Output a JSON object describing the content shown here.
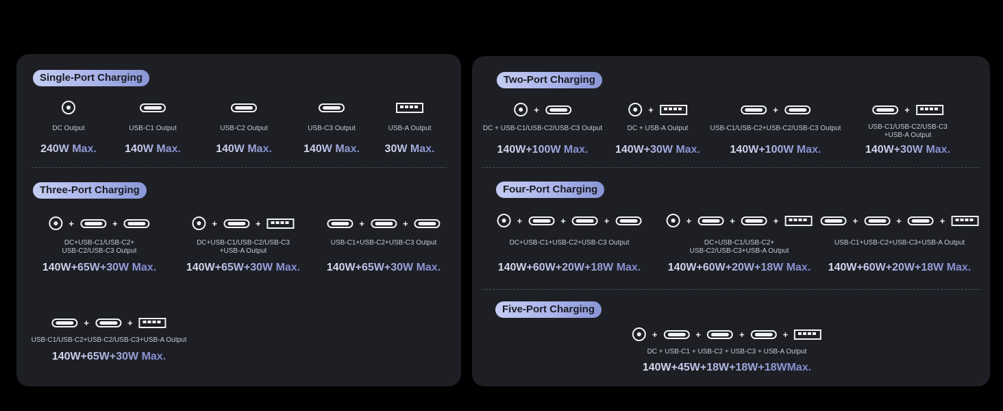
{
  "left": {
    "single": {
      "title": "Single-Port Charging",
      "items": [
        {
          "label": "DC Output",
          "value": "240W Max.",
          "icons": [
            "dc-icon"
          ]
        },
        {
          "label": "USB-C1 Output",
          "value": "140W Max.",
          "icons": [
            "usb-c-icon"
          ]
        },
        {
          "label": "USB-C2 Output",
          "value": "140W Max.",
          "icons": [
            "usb-c-icon"
          ]
        },
        {
          "label": "USB-C3 Output",
          "value": "140W Max.",
          "icons": [
            "usb-c-icon"
          ]
        },
        {
          "label": "USB-A Output",
          "value": "30W Max.",
          "icons": [
            "usb-a-icon"
          ]
        }
      ]
    },
    "three": {
      "title": "Three-Port Charging",
      "items": [
        {
          "label": "DC+USB-C1/USB-C2+\nUSB-C2/USB-C3 Output",
          "value": "140W+65W+30W Max.",
          "icons": [
            "dc-icon",
            "usb-c-icon",
            "usb-c-icon"
          ]
        },
        {
          "label": "DC+USB-C1/USB-C2/USB-C3\n+USB-A Output",
          "value": "140W+65W+30W Max.",
          "icons": [
            "dc-icon",
            "usb-c-icon",
            "usb-a-icon"
          ]
        },
        {
          "label": "USB-C1+USB-C2+USB-C3 Output",
          "value": "140W+65W+30W Max.",
          "icons": [
            "usb-c-icon",
            "usb-c-icon",
            "usb-c-icon"
          ]
        },
        {
          "label": "USB-C1/USB-C2+USB-C2/USB-C3+USB-A Output",
          "value": "140W+65W+30W Max.",
          "icons": [
            "usb-c-icon",
            "usb-c-icon",
            "usb-a-icon"
          ]
        }
      ]
    }
  },
  "right": {
    "two": {
      "title": "Two-Port Charging",
      "items": [
        {
          "label": "DC + USB-C1/USB-C2/USB-C3 Output",
          "value": "140W+100W Max.",
          "icons": [
            "dc-icon",
            "usb-c-icon"
          ]
        },
        {
          "label": "DC + USB-A Output",
          "value": "140W+30W Max.",
          "icons": [
            "dc-icon",
            "usb-a-icon"
          ]
        },
        {
          "label": "USB-C1/USB-C2+USB-C2/USB-C3 Output",
          "value": "140W+100W Max.",
          "icons": [
            "usb-c-icon",
            "usb-c-icon"
          ]
        },
        {
          "label": "USB-C1/USB-C2/USB-C3\n+USB-A Output",
          "value": "140W+30W Max.",
          "icons": [
            "usb-c-icon",
            "usb-a-icon"
          ]
        }
      ]
    },
    "four": {
      "title": "Four-Port Charging",
      "items": [
        {
          "label": "DC+USB-C1+USB-C2+USB-C3 Output",
          "value": "140W+60W+20W+18W Max.",
          "icons": [
            "dc-icon",
            "usb-c-icon",
            "usb-c-icon",
            "usb-c-icon"
          ]
        },
        {
          "label": "DC+USB-C1/USB-C2+\nUSB-C2/USB-C3+USB-A Output",
          "value": "140W+60W+20W+18W Max.",
          "icons": [
            "dc-icon",
            "usb-c-icon",
            "usb-c-icon",
            "usb-a-icon"
          ]
        },
        {
          "label": "USB-C1+USB-C2+USB-C3+USB-A Output",
          "value": "140W+60W+20W+18W Max.",
          "icons": [
            "usb-c-icon",
            "usb-c-icon",
            "usb-c-icon",
            "usb-a-icon"
          ]
        }
      ]
    },
    "five": {
      "title": "Five-Port Charging",
      "items": [
        {
          "label": "DC + USB-C1 + USB-C2 + USB-C3 + USB-A Output",
          "value": "140W+45W+18W+18W+18WMax.",
          "icons": [
            "dc-icon",
            "usb-c-icon",
            "usb-c-icon",
            "usb-c-icon",
            "usb-a-icon"
          ]
        }
      ]
    }
  }
}
